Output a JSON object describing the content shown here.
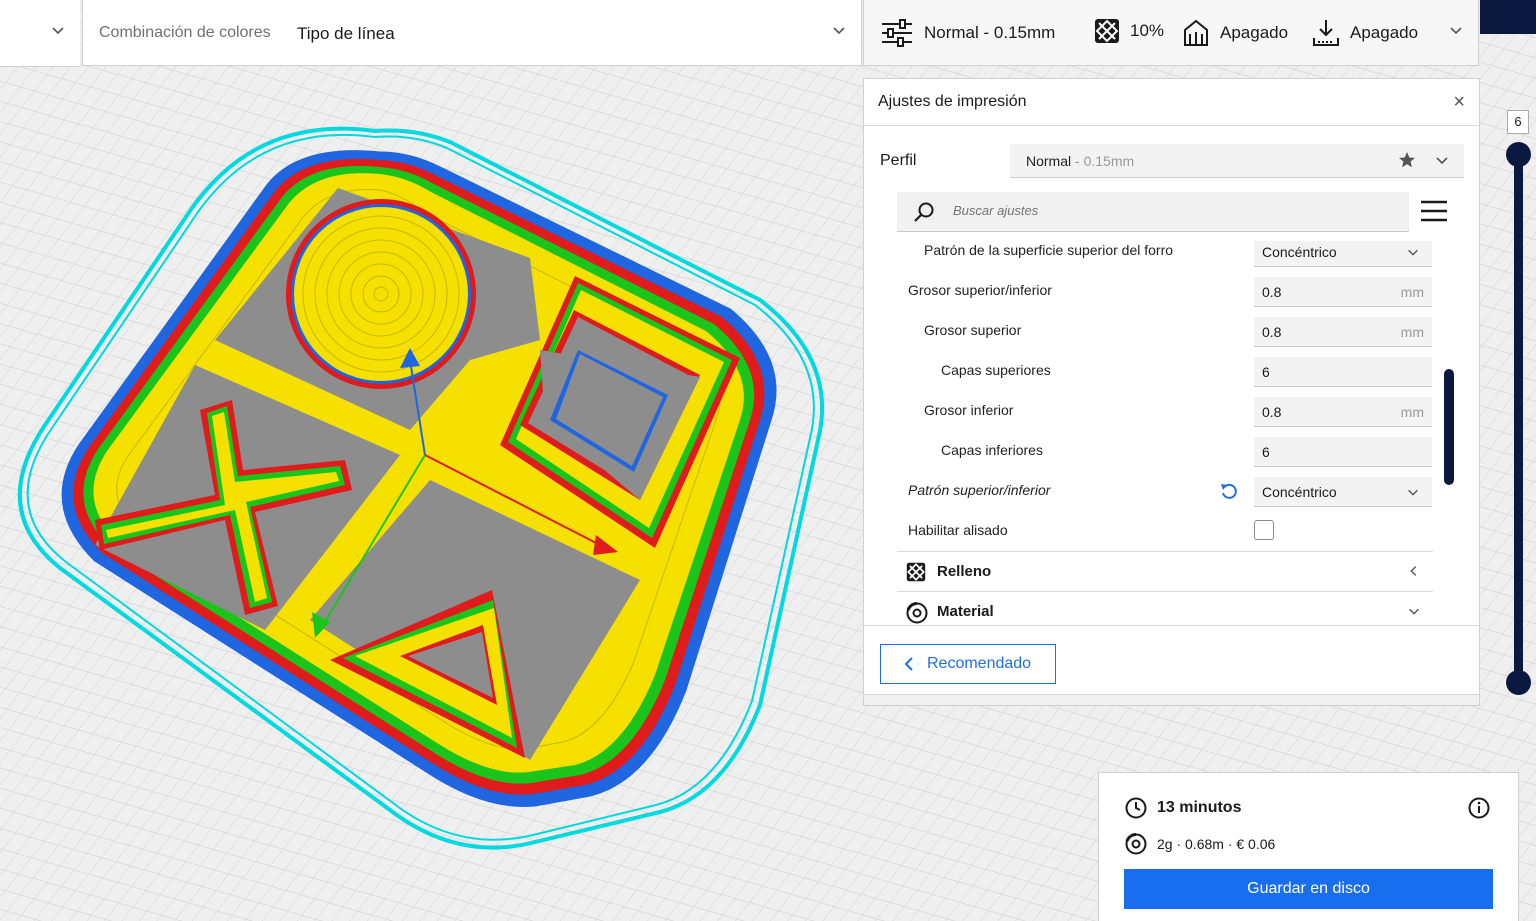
{
  "toolbar": {
    "view_label": "Combinación de colores",
    "view_value": "Tipo de línea",
    "profile": "Normal - 0.15mm",
    "infill": "10%",
    "support": "Apagado",
    "adhesion": "Apagado"
  },
  "panel": {
    "title": "Ajustes de impresión",
    "close": "×",
    "profile_label": "Perfil",
    "profile_name": "Normal",
    "profile_layer": " - 0.15mm",
    "search_placeholder": "Buscar ajustes",
    "settings": [
      {
        "label": "Patrón de la superficie superior del forro",
        "value": "Concéntrico"
      },
      {
        "label": "Grosor superior/inferior",
        "value": "0.8",
        "unit": "mm"
      },
      {
        "label": "Grosor superior",
        "value": "0.8",
        "unit": "mm"
      },
      {
        "label": "Capas superiores",
        "value": "6"
      },
      {
        "label": "Grosor inferior",
        "value": "0.8",
        "unit": "mm"
      },
      {
        "label": "Capas inferiores",
        "value": "6"
      },
      {
        "label": "Patrón superior/inferior",
        "value": "Concéntrico"
      },
      {
        "label": "Habilitar alisado",
        "checked": false
      }
    ],
    "sections": [
      "Relleno",
      "Material"
    ],
    "recommended_button": "Recomendado"
  },
  "layer_slider": {
    "value": "6"
  },
  "summary": {
    "time": "13 minutos",
    "material": "2g · 0.68m · € 0.06",
    "save_button": "Guardar en disco"
  },
  "colors": {
    "accent": "#196ef0",
    "navy": "#0b1940",
    "inner_wall": "#19c819",
    "outer_wall": "#e01b1b",
    "skin": "#ffee00",
    "skirt": "#00e5e5"
  }
}
